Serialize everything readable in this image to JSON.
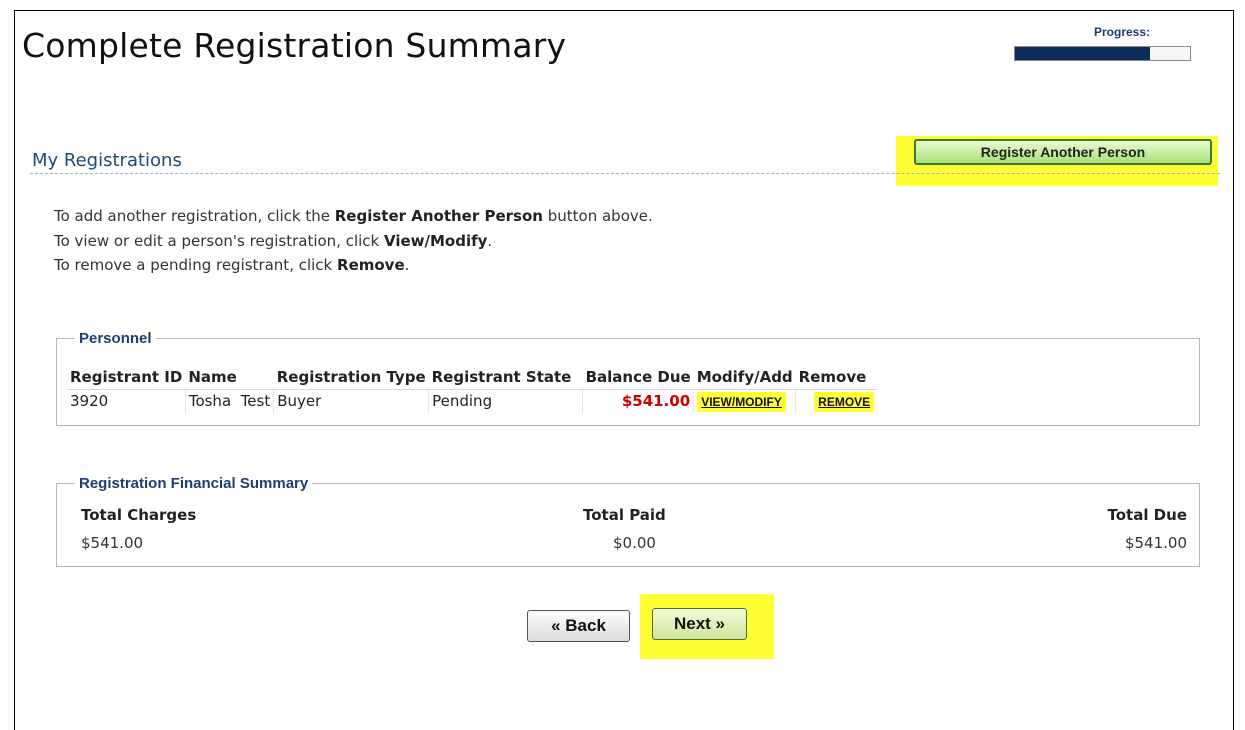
{
  "page": {
    "title": "Complete Registration Summary",
    "progress_label": "Progress:",
    "progress_fraction": 0.77
  },
  "section": {
    "title": "My Registrations",
    "register_button_label": "Register Another Person"
  },
  "instructions": [
    {
      "pre": "To add another registration, click the ",
      "bold": "Register Another Person",
      "post": " button above."
    },
    {
      "pre": "To view or edit a person's registration, click ",
      "bold": "View/Modify",
      "post": "."
    },
    {
      "pre": "To remove a pending registrant, click ",
      "bold": "Remove",
      "post": "."
    }
  ],
  "personnel": {
    "legend": "Personnel",
    "headers": [
      "Registrant ID",
      "Name",
      "Registration Type",
      "Registrant State",
      "Balance Due",
      "Modify/Add",
      "Remove"
    ],
    "rows": [
      {
        "id": "3920",
        "first": "Tosha",
        "last": "Test",
        "type": "Buyer",
        "state": "Pending",
        "balance": "$541.00",
        "modify": "VIEW/MODIFY",
        "remove": "REMOVE"
      }
    ]
  },
  "financial": {
    "legend": "Registration Financial Summary",
    "total_charges_label": "Total Charges",
    "total_paid_label": "Total Paid",
    "total_due_label": "Total Due",
    "total_charges": "$541.00",
    "total_paid": "$0.00",
    "total_due": "$541.00"
  },
  "nav": {
    "back_label": "« Back",
    "next_label": "Next »"
  },
  "colors": {
    "highlight": "#ffff33",
    "title_blue": "#1d4a7c",
    "balance_red": "#cc0000",
    "progress_fill": "#0d2d5a"
  }
}
